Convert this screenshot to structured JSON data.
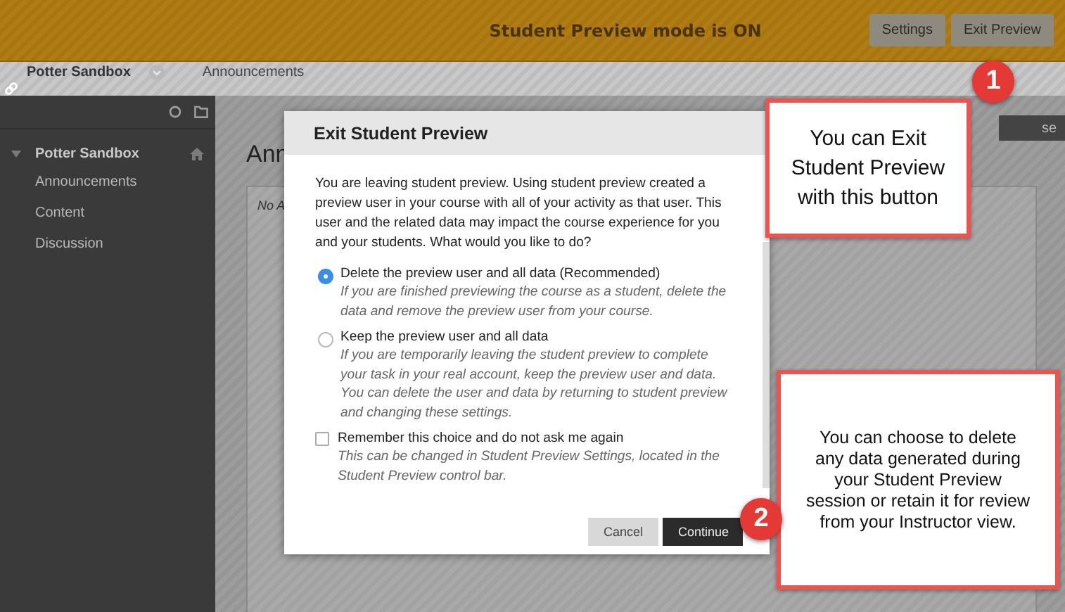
{
  "preview_bar": {
    "message": "Student Preview mode is ON",
    "buttons": [
      "Settings",
      "Exit Preview"
    ]
  },
  "breadcrumb": {
    "course": "Potter Sandbox",
    "page": "Announcements"
  },
  "sidebar": {
    "course": "Potter Sandbox",
    "items": [
      "Announcements",
      "Content",
      "Discussion"
    ]
  },
  "content": {
    "heading": "Ann",
    "notice": "No A",
    "corner_button": "se"
  },
  "dialog": {
    "title": "Exit Student Preview",
    "intro": "You are leaving student preview. Using student preview created a preview user in your course with all of your activity as that user. This user and the related data may impact the course experience for you and your students. What would you like to do?",
    "options": [
      {
        "label": "Delete the preview user and all data (Recommended)",
        "hint": "If you are finished previewing the course as a student, delete the data and remove the preview user from your course.",
        "selected": true
      },
      {
        "label": "Keep the preview user and all data",
        "hint": "If you are temporarily leaving the student preview to complete your task in your real account, keep the preview user and data. You can delete the user and data by returning to student preview and changing these settings.",
        "selected": false
      }
    ],
    "remember": {
      "label": "Remember this choice and do not ask me again",
      "hint": "This can be changed in Student Preview Settings, located in the Student Preview control bar.",
      "checked": false
    },
    "buttons": [
      {
        "label": "Cancel",
        "kind": "secondary"
      },
      {
        "label": "Continue",
        "kind": "primary"
      }
    ]
  },
  "callouts": [
    {
      "number": "1",
      "text": "You can Exit Student Preview with this button"
    },
    {
      "number": "2",
      "text": "You can choose to delete any data generated during your Student Preview session or retain it for review from your Instructor view."
    }
  ]
}
